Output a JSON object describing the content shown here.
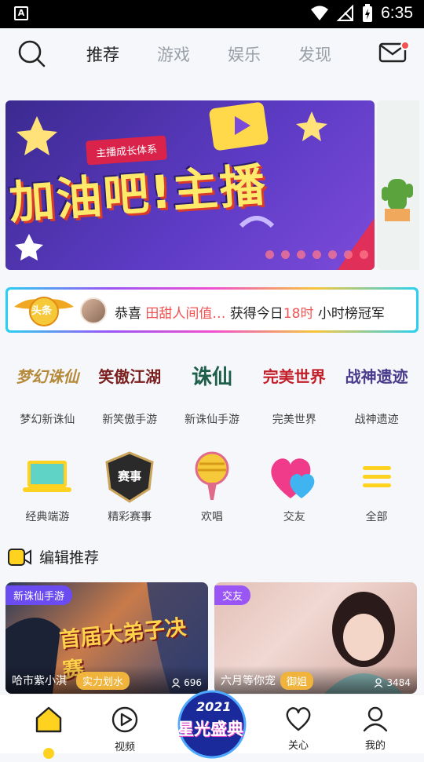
{
  "status_bar": {
    "left_icon": "A",
    "time": "6:35"
  },
  "top_nav": {
    "tabs": [
      "推荐",
      "游戏",
      "娱乐",
      "发现"
    ],
    "active_tab": 0
  },
  "banner": {
    "tag": "主播成长体系",
    "title": "加油吧!主播",
    "dots": 7
  },
  "headline": {
    "badge": "头条",
    "prefix": "恭喜",
    "name": "田甜人间值…",
    "middle": "获得今日",
    "hour": "18时",
    "suffix": "小时榜冠军"
  },
  "games": [
    {
      "label": "梦幻新诛仙",
      "logo": "梦幻诛仙",
      "color": "#b58a3a"
    },
    {
      "label": "新笑傲手游",
      "logo": "笑傲江湖",
      "color": "#7a1e1e"
    },
    {
      "label": "新诛仙手游",
      "logo": "诛仙",
      "color": "#1f5f4a"
    },
    {
      "label": "完美世界",
      "logo": "完美世界",
      "color": "#c21f2a"
    },
    {
      "label": "战神遗迹",
      "logo": "战神遗迹",
      "color": "#4b3c8e"
    }
  ],
  "categories": [
    {
      "label": "经典端游"
    },
    {
      "label": "精彩赛事",
      "icon_text": "赛事"
    },
    {
      "label": "欢唱"
    },
    {
      "label": "交友"
    },
    {
      "label": "全部"
    }
  ],
  "section": {
    "title": "编辑推荐"
  },
  "cards": [
    {
      "tag": "新诛仙手游",
      "cover_title": "首届大弟子决赛",
      "host": "哈市紫小淇",
      "host_tag": "实力划水",
      "viewers": "696"
    },
    {
      "tag": "交友",
      "host": "六月等你宠",
      "host_tag": "御姐",
      "viewers": "3484"
    }
  ],
  "bottom_nav": {
    "items": [
      "视频",
      "关心",
      "我的"
    ],
    "center": {
      "year": "2021",
      "text": "星光盛典"
    }
  }
}
